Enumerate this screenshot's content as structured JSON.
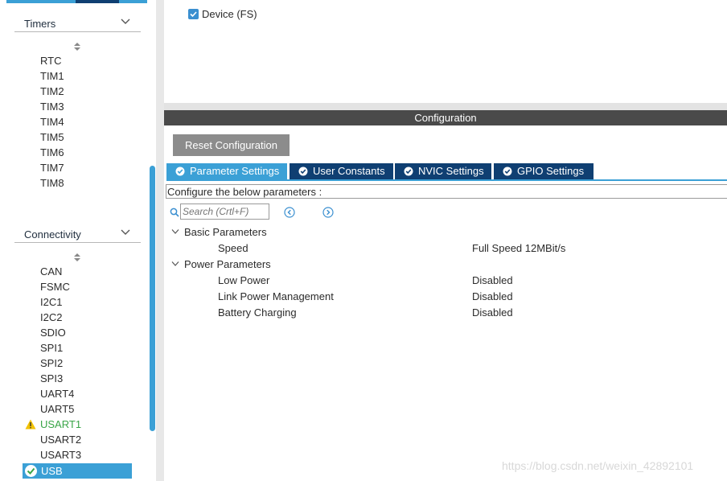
{
  "sidebar": {
    "timers": {
      "label": "Timers",
      "items": [
        "RTC",
        "TIM1",
        "TIM2",
        "TIM3",
        "TIM4",
        "TIM5",
        "TIM6",
        "TIM7",
        "TIM8"
      ]
    },
    "connectivity": {
      "label": "Connectivity",
      "items": [
        "CAN",
        "FSMC",
        "I2C1",
        "I2C2",
        "SDIO",
        "SPI1",
        "SPI2",
        "SPI3",
        "UART4",
        "UART5",
        "USART1",
        "USART2",
        "USART3",
        "USB"
      ],
      "warning_item": "USART1",
      "selected_item": "USB"
    }
  },
  "mode": {
    "device_label": "Device (FS)",
    "device_checked": true
  },
  "configuration": {
    "title": "Configuration",
    "reset_label": "Reset Configuration",
    "tabs": [
      "Parameter Settings",
      "User Constants",
      "NVIC Settings",
      "GPIO Settings"
    ],
    "active_tab": "Parameter Settings",
    "description": "Configure the below parameters :",
    "search_placeholder": "Search (Crtl+F)",
    "groups": [
      {
        "name": "Basic Parameters",
        "params": [
          {
            "name": "Speed",
            "value": "Full Speed 12MBit/s"
          }
        ]
      },
      {
        "name": "Power Parameters",
        "params": [
          {
            "name": "Low Power",
            "value": "Disabled"
          },
          {
            "name": "Link Power Management",
            "value": "Disabled"
          },
          {
            "name": "Battery Charging",
            "value": "Disabled"
          }
        ]
      }
    ]
  },
  "watermark": "https://blog.csdn.net/weixin_42892101",
  "colors": {
    "accent": "#3ba0d6",
    "tab_dark": "#0f3f72",
    "header_dark": "#4a4a4a",
    "button_gray": "#8c8c8c",
    "warning_text": "#3aa548",
    "warning_icon": "#f2c200"
  }
}
